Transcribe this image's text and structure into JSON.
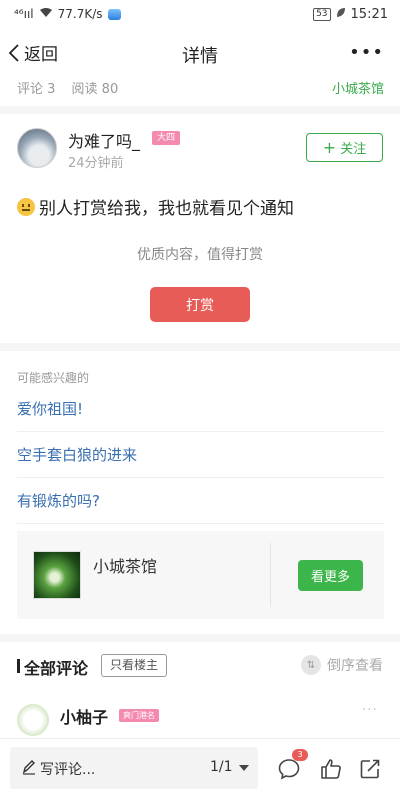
{
  "status_bar": {
    "signal": "⁴⁶ııl",
    "speed": "77.7K/s",
    "battery": "53",
    "time": "15:21"
  },
  "header": {
    "back_label": "返回",
    "title": "详情",
    "more_label": "•••"
  },
  "meta": {
    "comments": "评论 3",
    "reads": "阅读 80",
    "circle_name": "小城茶馆"
  },
  "post": {
    "author": "为难了吗_",
    "badge": "大四",
    "time": "24分钟前",
    "follow_label": "关注",
    "title": "别人打赏给我，我也就看见个通知",
    "reward_hint": "优质内容，值得打赏",
    "reward_label": "打赏"
  },
  "recommend": {
    "header": "可能感兴趣的",
    "items": [
      {
        "label": "爱你祖国!"
      },
      {
        "label": "空手套白狼的进来"
      },
      {
        "label": "有锻炼的吗?"
      }
    ]
  },
  "circle_card": {
    "name": "小城茶馆",
    "see_more_label": "看更多"
  },
  "comments": {
    "title": "全部评论",
    "owner_only_label": "只看楼主",
    "sort_label": "倒序查看",
    "first_user": "小柚子",
    "first_badge": "爽门港名",
    "more_label": "···"
  },
  "bottom_bar": {
    "write_label": "写评论...",
    "page": "1/1",
    "comment_count": "3"
  },
  "colors": {
    "accent_green": "#3aaa4a",
    "reward_red": "#e85c57",
    "link_blue": "#3a6fb0",
    "badge_pink": "#f48ab0"
  }
}
